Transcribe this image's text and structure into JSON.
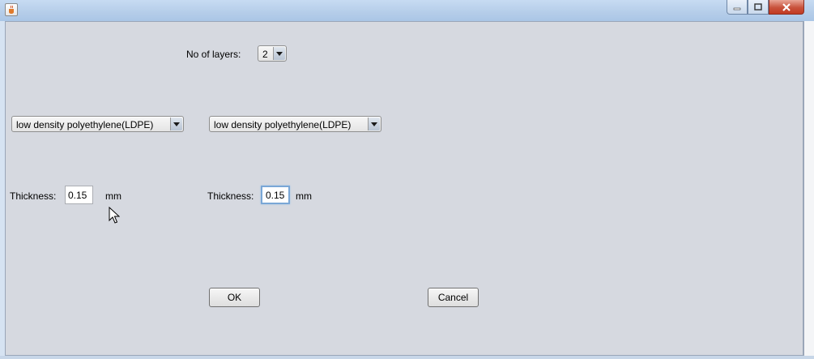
{
  "window": {
    "title": "",
    "icon": "java-cup-icon",
    "controls": [
      "minimize-icon",
      "maximize-icon",
      "close-icon"
    ]
  },
  "layers": {
    "label": "No of layers:",
    "value": "2"
  },
  "materials": [
    {
      "value": "low density polyethylene(LDPE)"
    },
    {
      "value": "low density polyethylene(LDPE)"
    }
  ],
  "thickness": [
    {
      "label": "Thickness:",
      "value": "0.15",
      "unit": "mm"
    },
    {
      "label": "Thickness:",
      "value": "0.15",
      "unit": "mm"
    }
  ],
  "buttons": {
    "ok": "OK",
    "cancel": "Cancel"
  }
}
